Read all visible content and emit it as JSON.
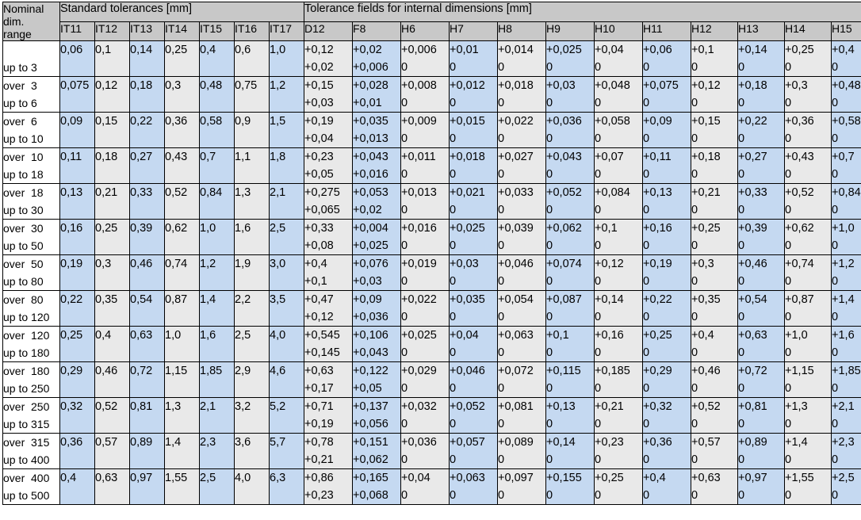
{
  "table": {
    "header": {
      "nominal_lines": [
        "Nominal",
        "dim.",
        "range"
      ],
      "group_standard": "Standard tolerances [mm]",
      "group_tolerance_fields": "Tolerance fields for internal dimensions [mm]",
      "it_columns": [
        "IT11",
        "IT12",
        "IT13",
        "IT14",
        "IT15",
        "IT16",
        "IT17"
      ],
      "tf_columns": [
        "D12",
        "F8",
        "H6",
        "H7",
        "H8",
        "H9",
        "H10",
        "H11",
        "H12",
        "H13",
        "H14",
        "H15"
      ]
    },
    "rows": [
      {
        "nominal": [
          "",
          "up to 3"
        ],
        "it": [
          "0,06",
          "0,1",
          "0,14",
          "0,25",
          "0,4",
          "0,6",
          "1,0"
        ],
        "tf": [
          [
            "+0,12",
            "+0,02"
          ],
          [
            "+0,02",
            "+0,006"
          ],
          [
            "+0,006",
            "0"
          ],
          [
            "+0,01",
            "0"
          ],
          [
            "+0,014",
            "0"
          ],
          [
            "+0,025",
            "0"
          ],
          [
            "+0,04",
            "0"
          ],
          [
            "+0,06",
            "0"
          ],
          [
            "+0,1",
            "0"
          ],
          [
            "+0,14",
            "0"
          ],
          [
            "+0,25",
            "0"
          ],
          [
            "+0,4",
            "0"
          ]
        ]
      },
      {
        "nominal": [
          "over  3",
          "up to 6"
        ],
        "it": [
          "0,075",
          "0,12",
          "0,18",
          "0,3",
          "0,48",
          "0,75",
          "1,2"
        ],
        "tf": [
          [
            "+0,15",
            "+0,03"
          ],
          [
            "+0,028",
            "+0,01"
          ],
          [
            "+0,008",
            "0"
          ],
          [
            "+0,012",
            "0"
          ],
          [
            "+0,018",
            "0"
          ],
          [
            "+0,03",
            "0"
          ],
          [
            "+0,048",
            "0"
          ],
          [
            "+0,075",
            "0"
          ],
          [
            "+0,12",
            "0"
          ],
          [
            "+0,18",
            "0"
          ],
          [
            "+0,3",
            "0"
          ],
          [
            "+0,48",
            "0"
          ]
        ]
      },
      {
        "nominal": [
          "over  6",
          "up to 10"
        ],
        "it": [
          "0,09",
          "0,15",
          "0,22",
          "0,36",
          "0,58",
          "0,9",
          "1,5"
        ],
        "tf": [
          [
            "+0,19",
            "+0,04"
          ],
          [
            "+0,035",
            "+0,013"
          ],
          [
            "+0,009",
            "0"
          ],
          [
            "+0,015",
            "0"
          ],
          [
            "+0,022",
            "0"
          ],
          [
            "+0,036",
            "0"
          ],
          [
            "+0,058",
            "0"
          ],
          [
            "+0,09",
            "0"
          ],
          [
            "+0,15",
            "0"
          ],
          [
            "+0,22",
            "0"
          ],
          [
            "+0,36",
            "0"
          ],
          [
            "+0,58",
            "0"
          ]
        ]
      },
      {
        "nominal": [
          "over  10",
          "up to 18"
        ],
        "it": [
          "0,11",
          "0,18",
          "0,27",
          "0,43",
          "0,7",
          "1,1",
          "1,8"
        ],
        "tf": [
          [
            "+0,23",
            "+0,05"
          ],
          [
            "+0,043",
            "+0,016"
          ],
          [
            "+0,011",
            "0"
          ],
          [
            "+0,018",
            "0"
          ],
          [
            "+0,027",
            "0"
          ],
          [
            "+0,043",
            "0"
          ],
          [
            "+0,07",
            "0"
          ],
          [
            "+0,11",
            "0"
          ],
          [
            "+0,18",
            "0"
          ],
          [
            "+0,27",
            "0"
          ],
          [
            "+0,43",
            "0"
          ],
          [
            "+0,7",
            "0"
          ]
        ]
      },
      {
        "nominal": [
          "over  18",
          "up to 30"
        ],
        "it": [
          "0,13",
          "0,21",
          "0,33",
          "0,52",
          "0,84",
          "1,3",
          "2,1"
        ],
        "tf": [
          [
            "+0,275",
            "+0,065"
          ],
          [
            "+0,053",
            "+0,02"
          ],
          [
            "+0,013",
            "0"
          ],
          [
            "+0,021",
            "0"
          ],
          [
            "+0,033",
            "0"
          ],
          [
            "+0,052",
            "0"
          ],
          [
            "+0,084",
            "0"
          ],
          [
            "+0,13",
            "0"
          ],
          [
            "+0,21",
            "0"
          ],
          [
            "+0,33",
            "0"
          ],
          [
            "+0,52",
            "0"
          ],
          [
            "+0,84",
            "0"
          ]
        ]
      },
      {
        "nominal": [
          "over  30",
          "up to 50"
        ],
        "it": [
          "0,16",
          "0,25",
          "0,39",
          "0,62",
          "1,0",
          "1,6",
          "2,5"
        ],
        "tf": [
          [
            "+0,33",
            "+0,08"
          ],
          [
            "+0,004",
            "+0,025"
          ],
          [
            "+0,016",
            "0"
          ],
          [
            "+0,025",
            "0"
          ],
          [
            "+0,039",
            "0"
          ],
          [
            "+0,062",
            "0"
          ],
          [
            "+0,1",
            "0"
          ],
          [
            "+0,16",
            "0"
          ],
          [
            "+0,25",
            "0"
          ],
          [
            "+0,39",
            "0"
          ],
          [
            "+0,62",
            "0"
          ],
          [
            "+1,0",
            "0"
          ]
        ]
      },
      {
        "nominal": [
          "over  50",
          "up to 80"
        ],
        "it": [
          "0,19",
          "0,3",
          "0,46",
          "0,74",
          "1,2",
          "1,9",
          "3,0"
        ],
        "tf": [
          [
            "+0,4",
            "+0,1"
          ],
          [
            "+0,076",
            "+0,03"
          ],
          [
            "+0,019",
            "0"
          ],
          [
            "+0,03",
            "0"
          ],
          [
            "+0,046",
            "0"
          ],
          [
            "+0,074",
            "0"
          ],
          [
            "+0,12",
            "0"
          ],
          [
            "+0,19",
            "0"
          ],
          [
            "+0,3",
            "0"
          ],
          [
            "+0,46",
            "0"
          ],
          [
            "+0,74",
            "0"
          ],
          [
            "+1,2",
            "0"
          ]
        ]
      },
      {
        "nominal": [
          "over  80",
          "up to 120"
        ],
        "it": [
          "0,22",
          "0,35",
          "0,54",
          "0,87",
          "1,4",
          "2,2",
          "3,5"
        ],
        "tf": [
          [
            "+0,47",
            "+0,12"
          ],
          [
            "+0,09",
            "+0,036"
          ],
          [
            "+0,022",
            "0"
          ],
          [
            "+0,035",
            "0"
          ],
          [
            "+0,054",
            "0"
          ],
          [
            "+0,087",
            "0"
          ],
          [
            "+0,14",
            "0"
          ],
          [
            "+0,22",
            "0"
          ],
          [
            "+0,35",
            "0"
          ],
          [
            "+0,54",
            "0"
          ],
          [
            "+0,87",
            "0"
          ],
          [
            "+1,4",
            "0"
          ]
        ]
      },
      {
        "nominal": [
          "over  120",
          "up to 180"
        ],
        "it": [
          "0,25",
          "0,4",
          "0,63",
          "1,0",
          "1,6",
          "2,5",
          "4,0"
        ],
        "tf": [
          [
            "+0,545",
            "+0,145"
          ],
          [
            "+0,106",
            "+0,043"
          ],
          [
            "+0,025",
            "0"
          ],
          [
            "+0,04",
            "0"
          ],
          [
            "+0,063",
            "0"
          ],
          [
            "+0,1",
            "0"
          ],
          [
            "+0,16",
            "0"
          ],
          [
            "+0,25",
            "0"
          ],
          [
            "+0,4",
            "0"
          ],
          [
            "+0,63",
            "0"
          ],
          [
            "+1,0",
            "0"
          ],
          [
            "+1,6",
            "0"
          ]
        ]
      },
      {
        "nominal": [
          "over  180",
          "up to 250"
        ],
        "it": [
          "0,29",
          "0,46",
          "0,72",
          "1,15",
          "1,85",
          "2,9",
          "4,6"
        ],
        "tf": [
          [
            "+0,63",
            "+0,17"
          ],
          [
            "+0,122",
            "+0,05"
          ],
          [
            "+0,029",
            "0"
          ],
          [
            "+0,046",
            "0"
          ],
          [
            "+0,072",
            "0"
          ],
          [
            "+0,115",
            "0"
          ],
          [
            "+0,185",
            "0"
          ],
          [
            "+0,29",
            "0"
          ],
          [
            "+0,46",
            "0"
          ],
          [
            "+0,72",
            "0"
          ],
          [
            "+1,15",
            "0"
          ],
          [
            "+1,85",
            "0"
          ]
        ]
      },
      {
        "nominal": [
          "over  250",
          "up to 315"
        ],
        "it": [
          "0,32",
          "0,52",
          "0,81",
          "1,3",
          "2,1",
          "3,2",
          "5,2"
        ],
        "tf": [
          [
            "+0,71",
            "+0,19"
          ],
          [
            "+0,137",
            "+0,056"
          ],
          [
            "+0,032",
            "0"
          ],
          [
            "+0,052",
            "0"
          ],
          [
            "+0,081",
            "0"
          ],
          [
            "+0,13",
            "0"
          ],
          [
            "+0,21",
            "0"
          ],
          [
            "+0,32",
            "0"
          ],
          [
            "+0,52",
            "0"
          ],
          [
            "+0,81",
            "0"
          ],
          [
            "+1,3",
            "0"
          ],
          [
            "+2,1",
            "0"
          ]
        ]
      },
      {
        "nominal": [
          "over  315",
          "up to 400"
        ],
        "it": [
          "0,36",
          "0,57",
          "0,89",
          "1,4",
          "2,3",
          "3,6",
          "5,7"
        ],
        "tf": [
          [
            "+0,78",
            "+0,21"
          ],
          [
            "+0,151",
            "+0,062"
          ],
          [
            "+0,036",
            "0"
          ],
          [
            "+0,057",
            "0"
          ],
          [
            "+0,089",
            "0"
          ],
          [
            "+0,14",
            "0"
          ],
          [
            "+0,23",
            "0"
          ],
          [
            "+0,36",
            "0"
          ],
          [
            "+0,57",
            "0"
          ],
          [
            "+0,89",
            "0"
          ],
          [
            "+1,4",
            "0"
          ],
          [
            "+2,3",
            "0"
          ]
        ]
      },
      {
        "nominal": [
          "over  400",
          "up to 500"
        ],
        "it": [
          "0,4",
          "0,63",
          "0,97",
          "1,55",
          "2,5",
          "4,0",
          "6,3"
        ],
        "tf": [
          [
            "+0,86",
            "+0,23"
          ],
          [
            "+0,165",
            "+0,068"
          ],
          [
            "+0,04",
            "0"
          ],
          [
            "+0,063",
            "0"
          ],
          [
            "+0,097",
            "0"
          ],
          [
            "+0,155",
            "0"
          ],
          [
            "+0,25",
            "0"
          ],
          [
            "+0,4",
            "0"
          ],
          [
            "+0,63",
            "0"
          ],
          [
            "+0,97",
            "0"
          ],
          [
            "+1,55",
            "0"
          ],
          [
            "+2,5",
            "0"
          ]
        ]
      }
    ]
  },
  "colors": {
    "header_bg": "#c8c8c8",
    "shade_blue": "#c5d9f1",
    "shade_grey": "#e9e9e9",
    "border": "#000000",
    "nominal_bg": "#ffffff"
  }
}
